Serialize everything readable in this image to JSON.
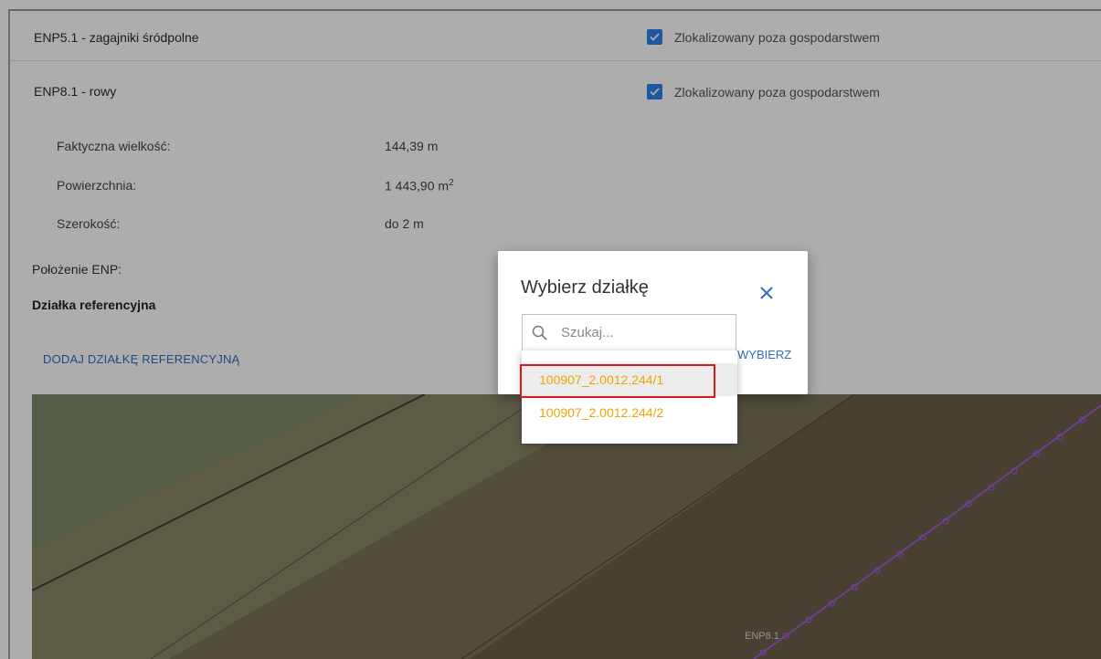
{
  "enp51": {
    "label": "ENP5.1 - zagajniki śródpolne",
    "checkbox_label": "Zlokalizowany poza gospodarstwem",
    "checked": true
  },
  "enp81": {
    "label": "ENP8.1 - rowy",
    "checkbox_label": "Zlokalizowany poza gospodarstwem",
    "checked": true
  },
  "properties": [
    {
      "label": "Faktyczna wielkość:",
      "value": "144,39 m"
    },
    {
      "label": "Powierzchnia:",
      "value": "1 443,90 m",
      "unit_sup": "2"
    },
    {
      "label": "Szerokość:",
      "value": "do 2 m"
    }
  ],
  "position_label": "Położenie ENP:",
  "reference": {
    "title": "Działka referencyjna",
    "add_link": "DODAJ DZIAŁKĘ REFERENCYJNĄ"
  },
  "map": {
    "feature_label": "ENP8.1",
    "line_color": "#a45ee5"
  },
  "dialog": {
    "title": "Wybierz działkę",
    "choose_button": "WYBIERZ",
    "search": {
      "placeholder": "Szukaj...",
      "value": ""
    },
    "options": [
      "100907_2.0012.244/1",
      "100907_2.0012.244/2"
    ]
  },
  "colors": {
    "accent": "#2f80ed",
    "link": "#2f6fbf",
    "option_text": "#f0a202",
    "highlight": "#e0141e"
  },
  "icons": {
    "checkbox": "check-icon",
    "close": "close-icon",
    "search": "search-icon"
  }
}
